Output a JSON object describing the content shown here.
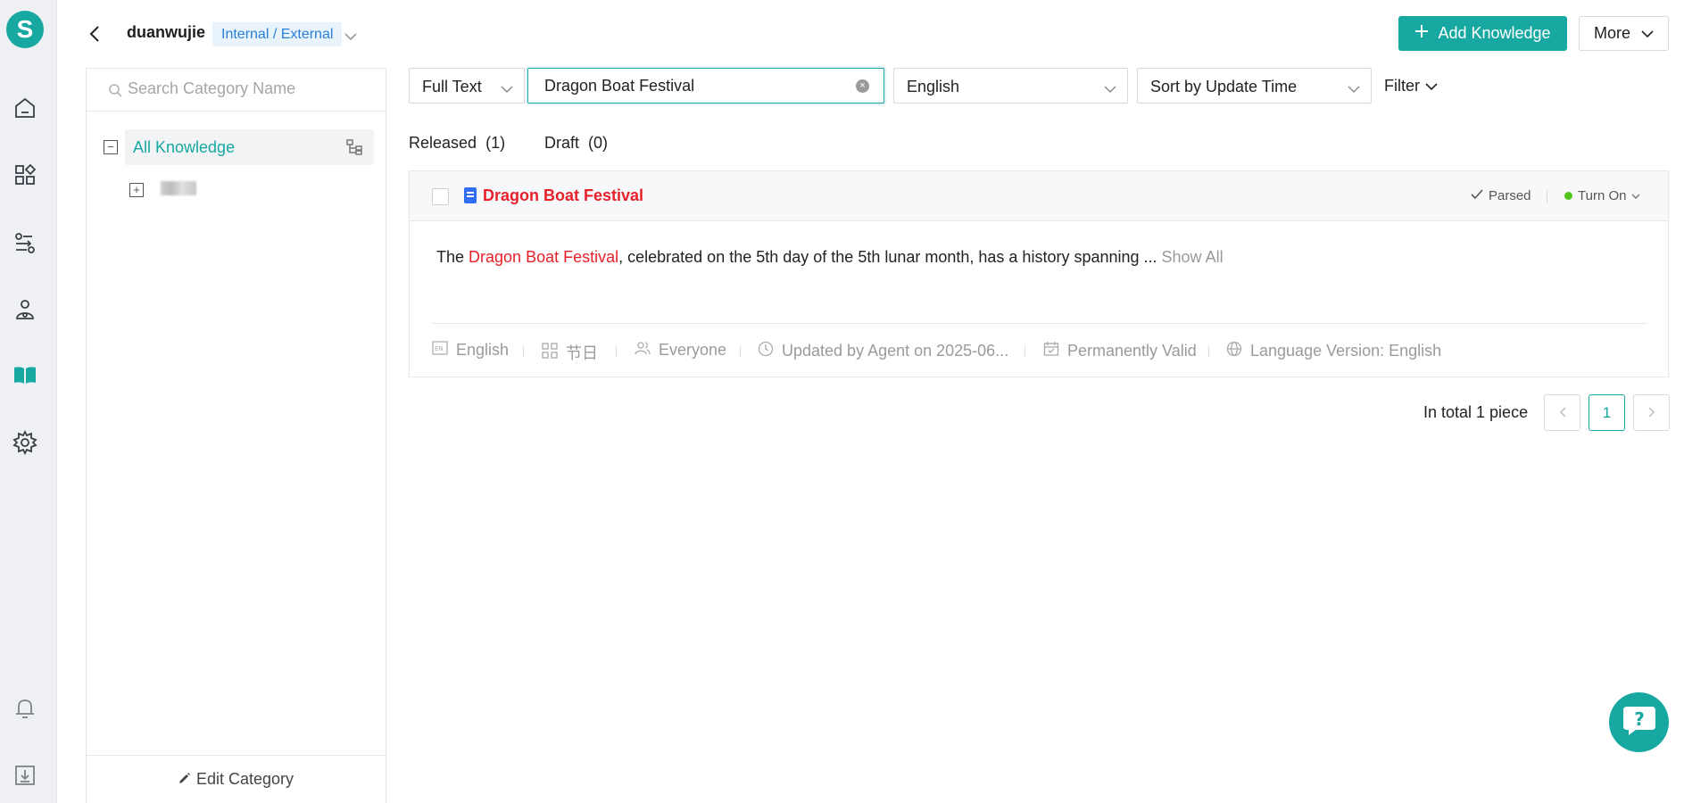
{
  "app": {
    "logo_letter": "S"
  },
  "rail": {
    "items": [
      "home-icon",
      "apps-icon",
      "flow-icon",
      "agent-icon",
      "knowledge-icon",
      "settings-icon"
    ],
    "bottom": [
      "bell-icon",
      "download-icon"
    ],
    "active": "knowledge-icon",
    "accent": "#17a8a1"
  },
  "header": {
    "workspace_name": "duanwujie",
    "workspace_tag": "Internal / External",
    "add_button": "Add Knowledge",
    "more_button": "More"
  },
  "category_panel": {
    "search_placeholder": "Search Category Name",
    "root_label": "All Knowledge",
    "footer_button": "Edit Category"
  },
  "filters": {
    "search_type": "Full Text",
    "search_value": "Dragon Boat Festival",
    "language": "English",
    "sort": "Sort by Update Time",
    "filter_label": "Filter"
  },
  "tabs": [
    {
      "label": "Released",
      "count": "(1)",
      "active": true
    },
    {
      "label": "Draft",
      "count": "(0)",
      "active": false
    }
  ],
  "results": [
    {
      "title": "Dragon Boat Festival",
      "status_parsed": "Parsed",
      "toggle_label": "Turn On",
      "body_prefix": "The ",
      "body_highlight": "Dragon Boat Festival",
      "body_suffix": ", celebrated on the 5th day of the 5th lunar month, has a history spanning ...",
      "show_all": "Show All",
      "meta": {
        "language": "English",
        "category": "节日",
        "audience": "Everyone",
        "updated": "Updated by Agent on 2025-06...",
        "validity": "Permanently Valid",
        "language_version": "Language Version: English"
      }
    }
  ],
  "pagination": {
    "total_text": "In total 1 piece",
    "current_page": "1"
  },
  "colors": {
    "accent": "#17a8a1",
    "highlight": "#e8202a",
    "tag_blue": "#2a7fd4"
  }
}
